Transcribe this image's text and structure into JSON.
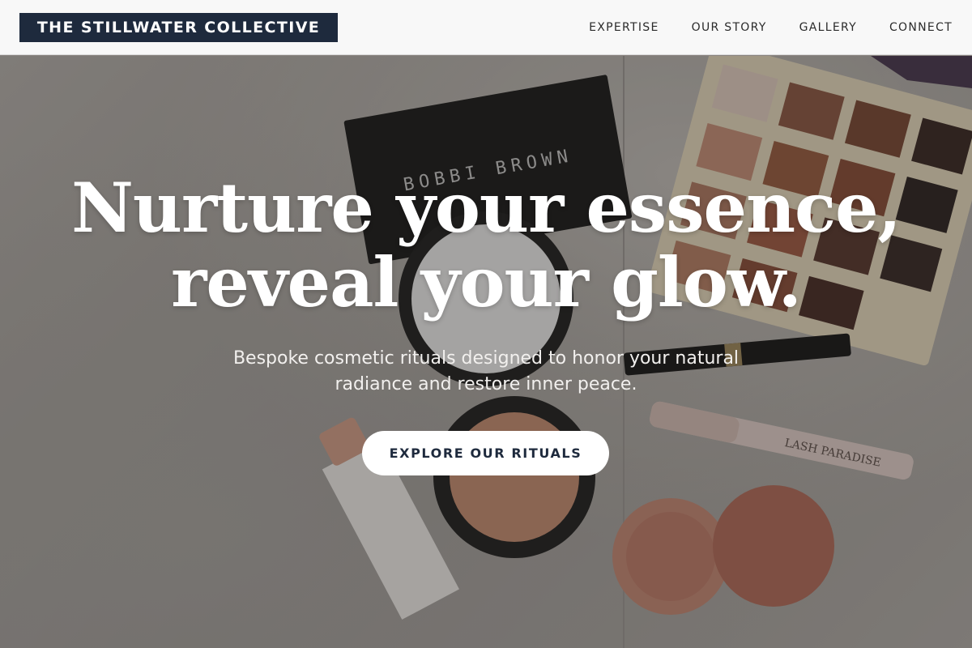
{
  "header": {
    "logo": "THE STILLWATER COLLECTIVE",
    "nav": [
      "EXPERTISE",
      "OUR STORY",
      "GALLERY",
      "CONNECT"
    ]
  },
  "hero": {
    "title_line1": "Nurture your essence,",
    "title_line2": "reveal your glow.",
    "subtitle_line1": "Bespoke cosmetic rituals designed to honor your natural",
    "subtitle_line2": "radiance and restore inner peace.",
    "cta_label": "EXPLORE OUR RITUALS",
    "photo_brand_text": "BOBBI BROWN",
    "photo_mascara_text": "LASH PARADISE"
  },
  "colors": {
    "brand_navy": "#1e2a3d",
    "header_bg": "#f8f8f8",
    "cta_bg": "#ffffff"
  }
}
